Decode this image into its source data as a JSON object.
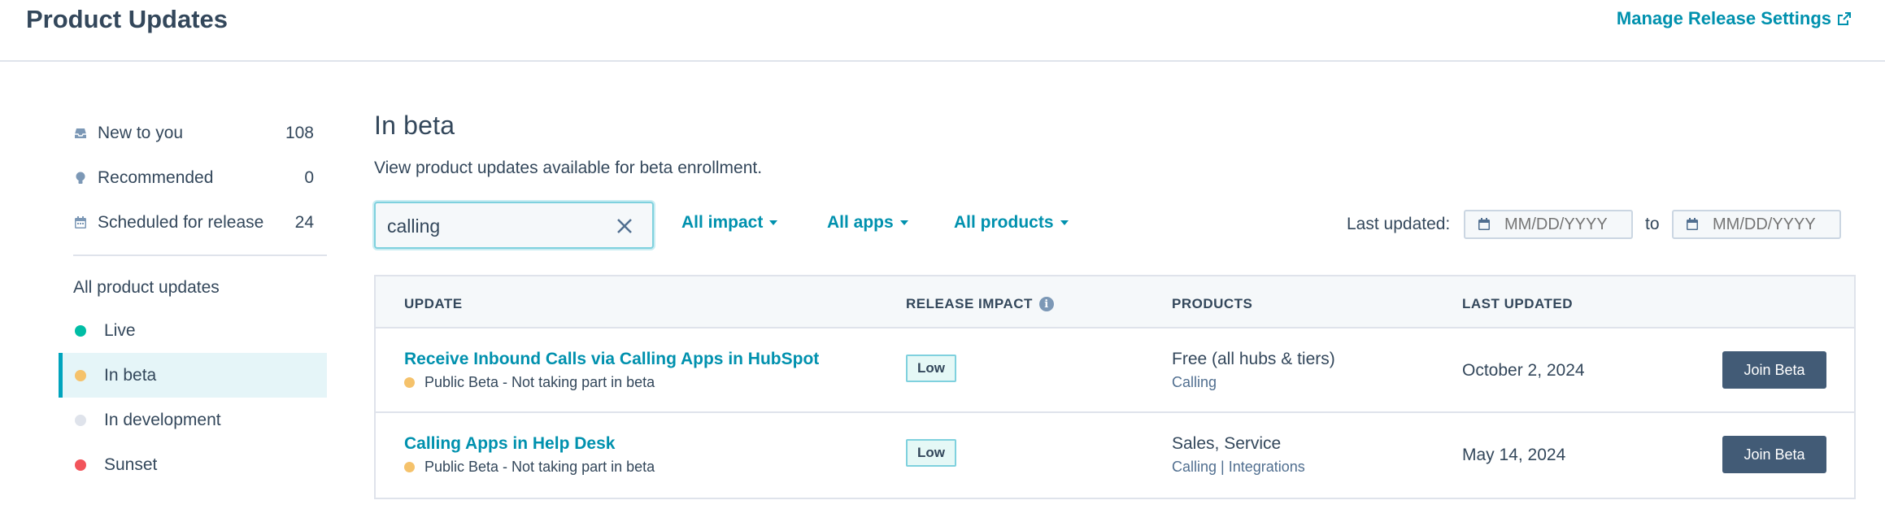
{
  "header": {
    "title": "Product Updates",
    "manage_link": "Manage Release Settings"
  },
  "sidebar": {
    "items": [
      {
        "label": "New to you",
        "count": "108",
        "icon": "inbox-icon"
      },
      {
        "label": "Recommended",
        "count": "0",
        "icon": "lightbulb-icon"
      },
      {
        "label": "Scheduled for release",
        "count": "24",
        "icon": "calendar-icon"
      }
    ],
    "heading": "All product updates",
    "statuses": [
      {
        "label": "Live",
        "color": "#00bda5"
      },
      {
        "label": "In beta",
        "color": "#f5c26b",
        "active": true
      },
      {
        "label": "In development",
        "color": "#dfe3eb"
      },
      {
        "label": "Sunset",
        "color": "#f2545b"
      }
    ]
  },
  "main": {
    "title": "In beta",
    "description": "View product updates available for beta enrollment.",
    "search_value": "calling",
    "filters": [
      "All impact",
      "All apps",
      "All products"
    ],
    "last_updated_label": "Last updated:",
    "date_placeholder": "MM/DD/YYYY",
    "to_label": "to"
  },
  "table": {
    "headers": {
      "update": "UPDATE",
      "impact": "RELEASE IMPACT",
      "products": "PRODUCTS",
      "last_updated": "LAST UPDATED"
    },
    "rows": [
      {
        "title": "Receive Inbound Calls via Calling Apps in HubSpot",
        "status": "Public Beta - Not taking part in beta",
        "status_color": "#f5c26b",
        "impact": "Low",
        "products": "Free (all hubs & tiers)",
        "products_sub": "Calling",
        "date": "October 2, 2024",
        "action": "Join Beta"
      },
      {
        "title": "Calling Apps in Help Desk",
        "status": "Public Beta - Not taking part in beta",
        "status_color": "#f5c26b",
        "impact": "Low",
        "products": "Sales, Service",
        "products_sub": "Calling | Integrations",
        "date": "May 14, 2024",
        "action": "Join Beta"
      }
    ]
  },
  "colors": {
    "accent": "#0091ae",
    "text": "#33475b",
    "button": "#425b76"
  }
}
